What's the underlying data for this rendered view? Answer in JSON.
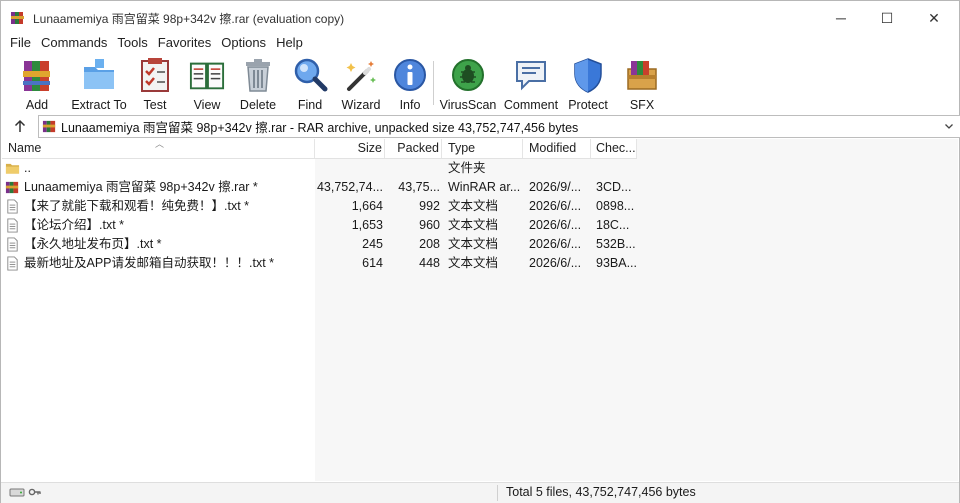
{
  "window": {
    "title": "Lunaamemiya 雨宫留菜 98p+342v 擦.rar (evaluation copy)",
    "controls": {
      "minimize": "─",
      "maximize": "☐",
      "close": "✕"
    }
  },
  "menu": [
    "File",
    "Commands",
    "Tools",
    "Favorites",
    "Options",
    "Help"
  ],
  "toolbar": [
    {
      "label": "Add",
      "icon": "archive-add-icon"
    },
    {
      "label": "Extract To",
      "icon": "folder-extract-icon"
    },
    {
      "label": "Test",
      "icon": "checklist-test-icon"
    },
    {
      "label": "View",
      "icon": "book-view-icon"
    },
    {
      "label": "Delete",
      "icon": "trash-can-icon"
    },
    {
      "label": "Find",
      "icon": "magnifier-find-icon"
    },
    {
      "label": "Wizard",
      "icon": "magic-wand-icon"
    },
    {
      "label": "Info",
      "icon": "info-icon"
    },
    {
      "label": "VirusScan",
      "icon": "virus-scan-icon"
    },
    {
      "label": "Comment",
      "icon": "comment-icon"
    },
    {
      "label": "Protect",
      "icon": "shield-protect-icon"
    },
    {
      "label": "SFX",
      "icon": "sfx-box-icon"
    }
  ],
  "address": {
    "text": "Lunaamemiya 雨宫留菜 98p+342v 擦.rar - RAR archive, unpacked size 43,752,747,456 bytes"
  },
  "columns": {
    "name": "Name",
    "size": "Size",
    "packed": "Packed",
    "type": "Type",
    "modified": "Modified",
    "checksum": "Chec..."
  },
  "files": [
    {
      "icon": "folder",
      "name": "..",
      "size": "",
      "packed": "",
      "type": "文件夹",
      "modified": "",
      "checksum": ""
    },
    {
      "icon": "rar",
      "name": "Lunaamemiya 雨宫留菜 98p+342v 擦.rar *",
      "size": "43,752,74...",
      "packed": "43,75...",
      "type": "WinRAR ar...",
      "modified": "2026/9/...",
      "checksum": "3CD..."
    },
    {
      "icon": "txt",
      "name": "【来了就能下载和观看！纯免费！】.txt *",
      "size": "1,664",
      "packed": "992",
      "type": "文本文档",
      "modified": "2026/6/...",
      "checksum": "0898..."
    },
    {
      "icon": "txt",
      "name": "【论坛介绍】.txt *",
      "size": "1,653",
      "packed": "960",
      "type": "文本文档",
      "modified": "2026/6/...",
      "checksum": "18C..."
    },
    {
      "icon": "txt",
      "name": "【永久地址发布页】.txt *",
      "size": "245",
      "packed": "208",
      "type": "文本文档",
      "modified": "2026/6/...",
      "checksum": "532B..."
    },
    {
      "icon": "txt",
      "name": "最新地址及APP请发邮箱自动获取！！！.txt *",
      "size": "614",
      "packed": "448",
      "type": "文本文档",
      "modified": "2026/6/...",
      "checksum": "93BA..."
    }
  ],
  "status": {
    "summary": "Total 5 files, 43,752,747,456 bytes"
  }
}
